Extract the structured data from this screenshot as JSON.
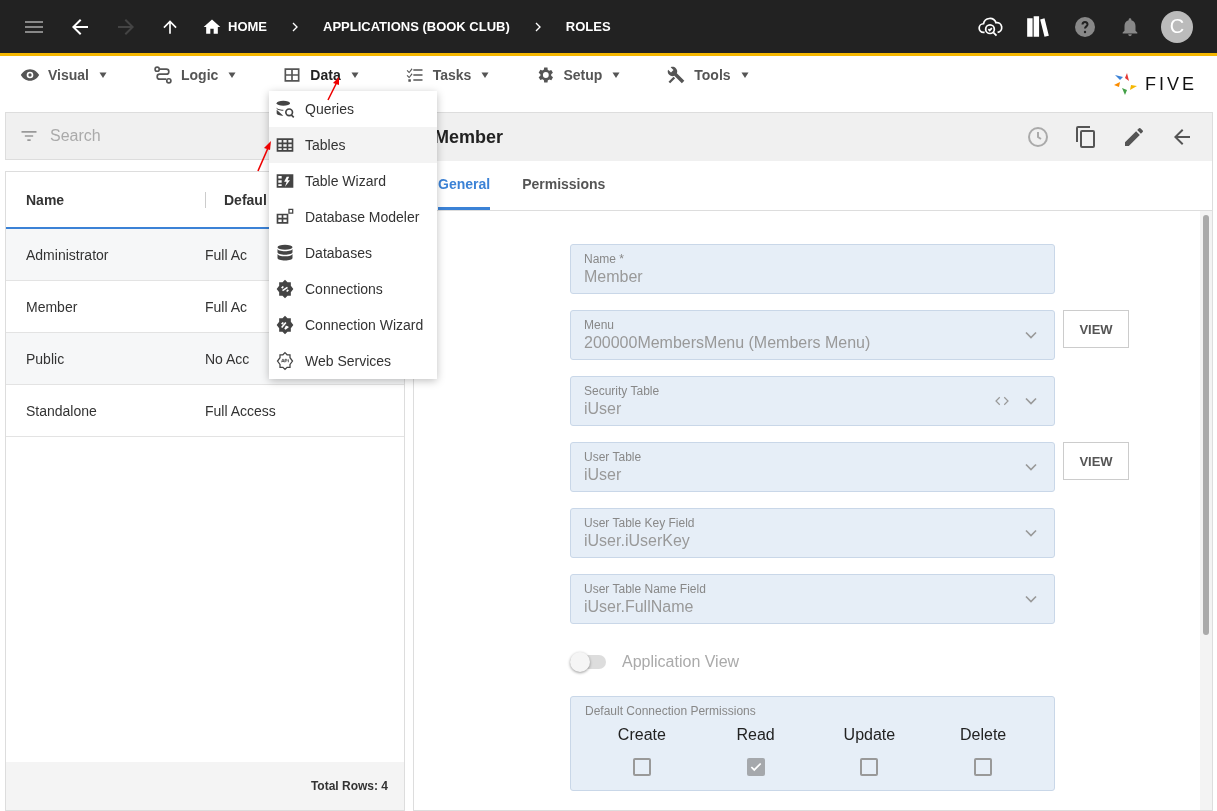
{
  "breadcrumbs": [
    {
      "label": "HOME",
      "kind": "home"
    },
    {
      "label": "APPLICATIONS (BOOK CLUB)",
      "kind": "plain"
    },
    {
      "label": "ROLES",
      "kind": "plain"
    }
  ],
  "avatar": "C",
  "menubar": [
    {
      "label": "Visual",
      "open": false
    },
    {
      "label": "Logic",
      "open": false
    },
    {
      "label": "Data",
      "open": true
    },
    {
      "label": "Tasks",
      "open": false
    },
    {
      "label": "Setup",
      "open": false
    },
    {
      "label": "Tools",
      "open": false
    }
  ],
  "logo": "FIVE",
  "data_menu": [
    {
      "label": "Queries",
      "hovered": false
    },
    {
      "label": "Tables",
      "hovered": true
    },
    {
      "label": "Table Wizard",
      "hovered": false
    },
    {
      "label": "Database Modeler",
      "hovered": false
    },
    {
      "label": "Databases",
      "hovered": false
    },
    {
      "label": "Connections",
      "hovered": false
    },
    {
      "label": "Connection Wizard",
      "hovered": false
    },
    {
      "label": "Web Services",
      "hovered": false
    }
  ],
  "search": {
    "placeholder": "Search"
  },
  "table": {
    "columns": [
      "Name",
      "Defaul"
    ],
    "rows": [
      [
        "Administrator",
        "Full Ac"
      ],
      [
        "Member",
        "Full Ac"
      ],
      [
        "Public",
        "No Acc"
      ],
      [
        "Standalone",
        "Full Access"
      ]
    ],
    "footer": "Total Rows: 4"
  },
  "record": {
    "title": "Member",
    "tabs": [
      {
        "label": "General",
        "selected": true
      },
      {
        "label": "Permissions",
        "selected": false
      }
    ],
    "fields": [
      {
        "label": "Name *",
        "value": "Member",
        "kind": "text"
      },
      {
        "label": "Menu",
        "value": "200000MembersMenu (Members Menu)",
        "kind": "select",
        "button": "VIEW"
      },
      {
        "label": "Security Table",
        "value": "iUser",
        "kind": "select-code"
      },
      {
        "label": "User Table",
        "value": "iUser",
        "kind": "select",
        "button": "VIEW"
      },
      {
        "label": "User Table Key Field",
        "value": "iUser.iUserKey",
        "kind": "select"
      },
      {
        "label": "User Table Name Field",
        "value": "iUser.FullName",
        "kind": "select"
      }
    ],
    "toggle": {
      "label": "Application View",
      "on": false
    },
    "permissions": {
      "title": "Default Connection Permissions",
      "items": [
        {
          "label": "Create",
          "checked": false
        },
        {
          "label": "Read",
          "checked": true
        },
        {
          "label": "Update",
          "checked": false
        },
        {
          "label": "Delete",
          "checked": false
        }
      ]
    }
  }
}
